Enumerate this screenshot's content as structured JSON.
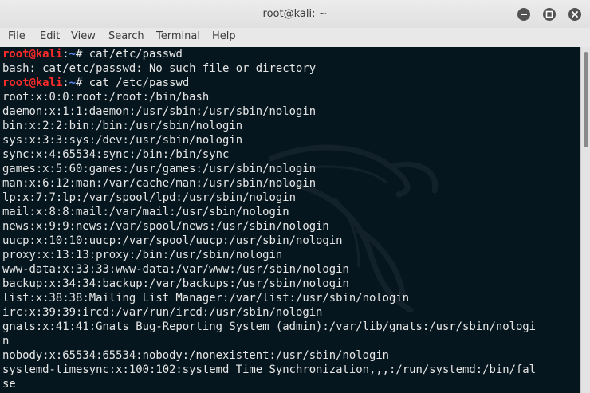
{
  "window": {
    "title": "root@kali: ~"
  },
  "menubar": {
    "items": [
      "File",
      "Edit",
      "View",
      "Search",
      "Terminal",
      "Help"
    ]
  },
  "terminal": {
    "prompts": [
      {
        "user": "root@kali",
        "sep": ":",
        "path": "~",
        "symbol": "# ",
        "command": "cat/etc/passwd"
      },
      {
        "user": "root@kali",
        "sep": ":",
        "path": "~",
        "symbol": "# ",
        "command": "cat /etc/passwd"
      }
    ],
    "error_line": "bash: cat/etc/passwd: No such file or directory",
    "output": [
      "root:x:0:0:root:/root:/bin/bash",
      "daemon:x:1:1:daemon:/usr/sbin:/usr/sbin/nologin",
      "bin:x:2:2:bin:/bin:/usr/sbin/nologin",
      "sys:x:3:3:sys:/dev:/usr/sbin/nologin",
      "sync:x:4:65534:sync:/bin:/bin/sync",
      "games:x:5:60:games:/usr/games:/usr/sbin/nologin",
      "man:x:6:12:man:/var/cache/man:/usr/sbin/nologin",
      "lp:x:7:7:lp:/var/spool/lpd:/usr/sbin/nologin",
      "mail:x:8:8:mail:/var/mail:/usr/sbin/nologin",
      "news:x:9:9:news:/var/spool/news:/usr/sbin/nologin",
      "uucp:x:10:10:uucp:/var/spool/uucp:/usr/sbin/nologin",
      "proxy:x:13:13:proxy:/bin:/usr/sbin/nologin",
      "www-data:x:33:33:www-data:/var/www:/usr/sbin/nologin",
      "backup:x:34:34:backup:/var/backups:/usr/sbin/nologin",
      "list:x:38:38:Mailing List Manager:/var/list:/usr/sbin/nologin",
      "irc:x:39:39:ircd:/var/run/ircd:/usr/sbin/nologin",
      "gnats:x:41:41:Gnats Bug-Reporting System (admin):/var/lib/gnats:/usr/sbin/nologi",
      "n",
      "nobody:x:65534:65534:nobody:/nonexistent:/usr/sbin/nologin",
      "systemd-timesync:x:100:102:systemd Time Synchronization,,,:/run/systemd:/bin/fal",
      "se"
    ]
  },
  "colors": {
    "background": "#06161e",
    "text": "#e6e6e6",
    "prompt_user": "#ff2b2b",
    "prompt_path": "#5d8bf2"
  },
  "icons": [
    "minimize-icon",
    "maximize-icon",
    "close-icon",
    "kali-dragon-watermark"
  ]
}
